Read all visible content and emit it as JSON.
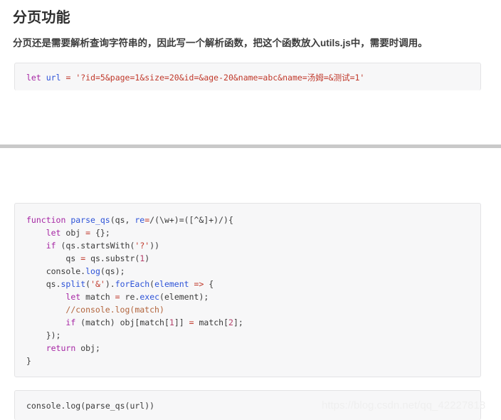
{
  "article": {
    "title": "分页功能",
    "intro": "分页还是需要解析查询字符串的，因此写一个解析函数，把这个函数放入utils.js中，需要时调用。",
    "divider": true
  },
  "code_blocks": [
    {
      "id": "url-declaration",
      "language": "javascript",
      "lines": [
        "let url = '?id=5&page=1&size=20&id=&age-20&name=abc&name=汤姆=&测试=1'"
      ]
    },
    {
      "id": "parse-qs-function",
      "language": "javascript",
      "lines": [
        "function parse_qs(qs, re=/(\\w+)=([^&]+)/){",
        "    let obj = {};",
        "    if (qs.startsWith('?'))",
        "        qs = qs.substr(1)",
        "    console.log(qs);",
        "    qs.split('&').forEach(element => {",
        "        let match = re.exec(element);",
        "        //console.log(match)",
        "        if (match) obj[match[1]] = match[2];",
        "    });",
        "    return obj;",
        "}"
      ]
    },
    {
      "id": "function-call",
      "language": "javascript",
      "lines": [
        "console.log(parse_qs(url))"
      ]
    }
  ],
  "watermark": {
    "text": "https://blog.csdn.net/qq_42227818"
  },
  "colors": {
    "page_background": "#ffffff",
    "code_background": "#f7f7f8",
    "code_border": "#e3e3e5",
    "divider": "#c9c9c9",
    "heading": "#2f2f2f",
    "body_text": "#3c3c3c",
    "keyword": "#a626a4",
    "function_name": "#2d53d8",
    "string": "#c0392b",
    "number": "#b5416a",
    "comment": "#b2643c",
    "watermark": "#efefef"
  }
}
